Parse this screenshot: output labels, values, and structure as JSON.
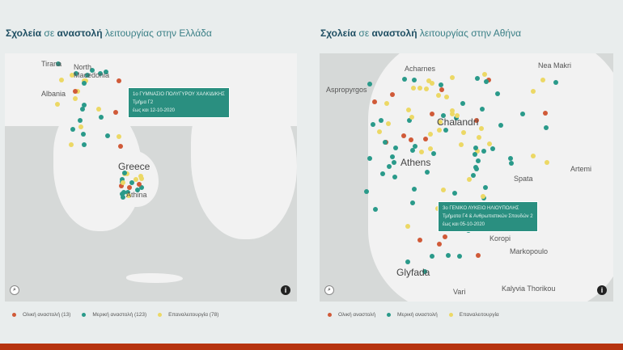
{
  "colors": {
    "full": "#d05a38",
    "partial": "#2a9a8a",
    "reopen": "#ecd865",
    "accent": "#b6330f"
  },
  "greece": {
    "title_bold1": "Σχολεία",
    "title_mid": " σε ",
    "title_bold2": "αναστολή",
    "title_rest": " λειτουργίας στην Ελλάδα",
    "labels": [
      "Tirana",
      "North Macedonia",
      "Albania",
      "Greece",
      "Athina"
    ],
    "tooltip": {
      "line1": "1ο ΓΥΜΝΑΣΙΟ ΠΟΛΥΓΥΡΟΥ ΧΑΛΚΙΔΙΚΗΣ",
      "line2": "Τμήμα Γ2",
      "line3": "έως και 12-10-2020"
    },
    "legend": [
      "Ολική αναστολή (13)",
      "Μερική αναστολή (123)",
      "Επαναλειτουργία (78)"
    ]
  },
  "athens": {
    "title_bold1": "Σχολεία",
    "title_mid": " σε ",
    "title_bold2": "αναστολή",
    "title_rest": " λειτουργίας στην Αθήνα",
    "labels": [
      "Acharnes",
      "Aspropyrgos",
      "Chalandri",
      "Athens",
      "Spata",
      "Koropi",
      "Markopoulo",
      "Glyfada",
      "Vari",
      "Kalyvia Thorikou",
      "Nea Makri",
      "Artemi"
    ],
    "tooltip": {
      "line1": "3ο ΓΕΝΙΚΟ ΛΥΚΕΙΟ ΗΛΙΟΥΠΟΛΗΣ",
      "line2": "Τμήματα Γ4 & Ανθρωπιστικών Σπουδών 2",
      "line3": "έως και 05-10-2020"
    },
    "legend": [
      "Ολική αναστολή",
      "Μερική αναστολή",
      "Επαναλειτουργία"
    ]
  },
  "info_icon": "i"
}
